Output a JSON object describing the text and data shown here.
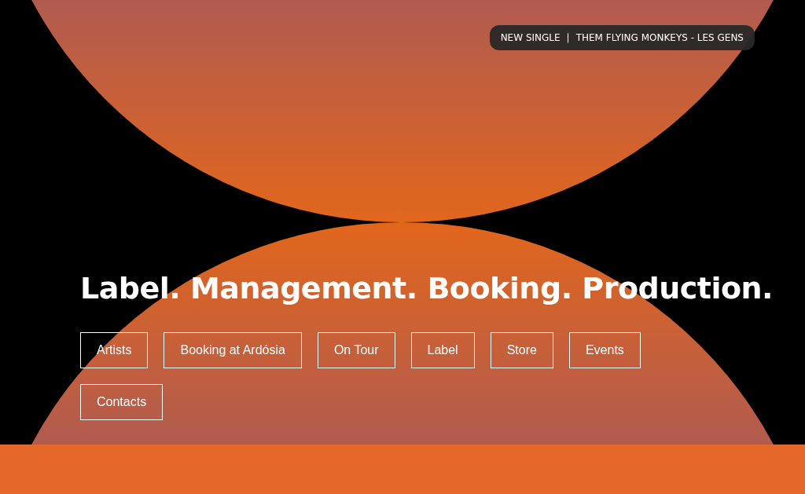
{
  "ticker": {
    "label": "NEW SINGLE",
    "separator": "|",
    "text": "THEM FLYING MONKEYS - LES GENS"
  },
  "headline": "Label. Management. Booking. Production.",
  "nav_buttons": [
    "Artists",
    "Booking at Ardósia",
    "On Tour",
    "Label",
    "Store",
    "Events",
    "Contacts"
  ]
}
